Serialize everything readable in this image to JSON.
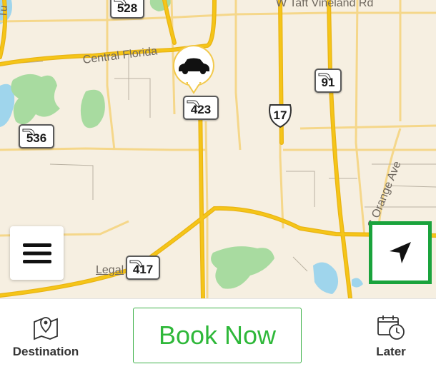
{
  "map": {
    "road_labels": {
      "central_florida": "Central Florida",
      "w_taft_vineland": "W Taft Vineland Rd",
      "s_orange_ave": "S Orange Ave",
      "legal": "Legal",
      "tu": "Tu"
    },
    "shields": {
      "s528": "528",
      "s91": "91",
      "s423": "423",
      "s536": "536",
      "s417": "417",
      "us17": "17"
    },
    "colors": {
      "land": "#f6efe1",
      "park": "#a8dba0",
      "water": "#9fd5ec",
      "highway": "#f5c518",
      "road_minor": "#f5d78a",
      "locate_highlight": "#1aa33c",
      "book_now": "#2fb83a"
    },
    "controls": {
      "menu_icon": "hamburger-menu-icon",
      "locate_icon": "navigation-arrow-icon",
      "vehicle_icon": "car-icon"
    }
  },
  "bottom_bar": {
    "destination_label": "Destination",
    "book_now_label": "Book Now",
    "later_label": "Later",
    "destination_icon": "map-pin-icon",
    "later_icon": "calendar-clock-icon"
  }
}
